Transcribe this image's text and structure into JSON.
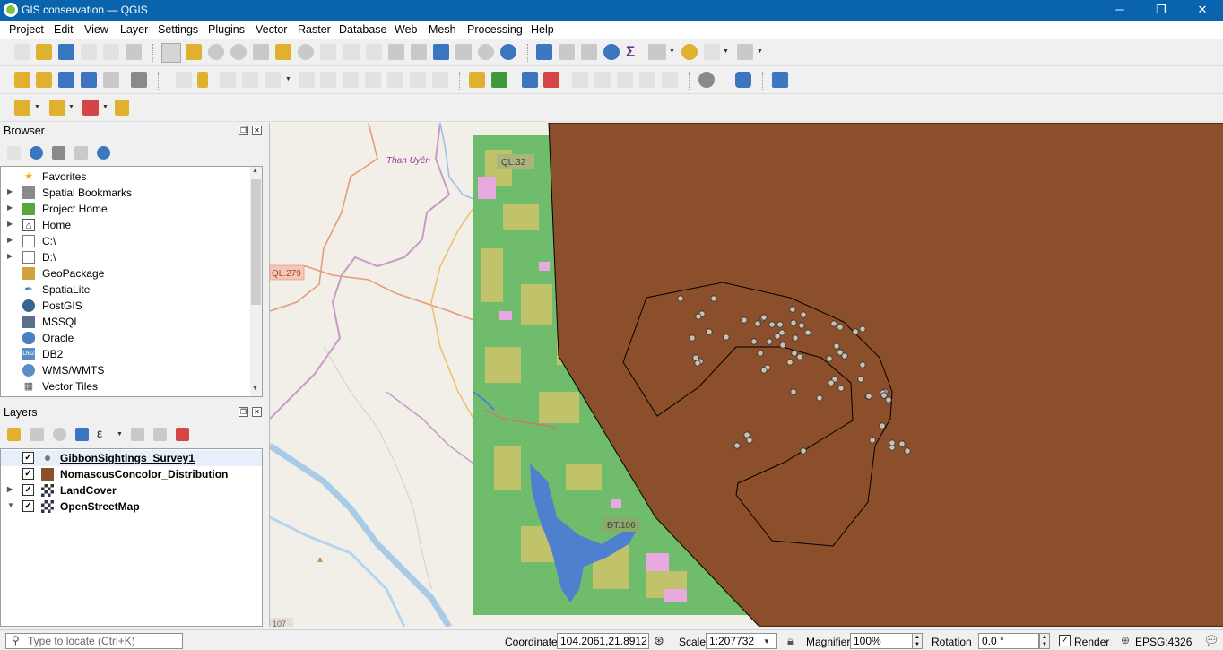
{
  "window": {
    "title": "GIS conservation — QGIS",
    "controls": [
      "─",
      "❐",
      "✕"
    ]
  },
  "menu": [
    "Project",
    "Edit",
    "View",
    "Layer",
    "Settings",
    "Plugins",
    "Vector",
    "Raster",
    "Database",
    "Web",
    "Mesh",
    "Processing",
    "Help"
  ],
  "browser": {
    "title": "Browser",
    "items": [
      {
        "label": "Favorites",
        "icon": "star-icon",
        "arrow": ""
      },
      {
        "label": "Spatial Bookmarks",
        "icon": "bookmark-icon",
        "arrow": "▶"
      },
      {
        "label": "Project Home",
        "icon": "project-home-icon",
        "arrow": "▶"
      },
      {
        "label": "Home",
        "icon": "home-icon",
        "arrow": "▶"
      },
      {
        "label": "C:\\",
        "icon": "folder-icon",
        "arrow": "▶"
      },
      {
        "label": "D:\\",
        "icon": "folder-icon",
        "arrow": "▶"
      },
      {
        "label": "GeoPackage",
        "icon": "geopackage-icon",
        "arrow": ""
      },
      {
        "label": "SpatiaLite",
        "icon": "spatialite-icon",
        "arrow": ""
      },
      {
        "label": "PostGIS",
        "icon": "postgis-icon",
        "arrow": ""
      },
      {
        "label": "MSSQL",
        "icon": "mssql-icon",
        "arrow": ""
      },
      {
        "label": "Oracle",
        "icon": "oracle-icon",
        "arrow": ""
      },
      {
        "label": "DB2",
        "icon": "db2-icon",
        "arrow": ""
      },
      {
        "label": "WMS/WMTS",
        "icon": "globe-icon",
        "arrow": ""
      },
      {
        "label": "Vector Tiles",
        "icon": "grid-icon",
        "arrow": ""
      }
    ]
  },
  "layers": {
    "title": "Layers",
    "items": [
      {
        "label": "GibbonSightings_Survey1",
        "checked": true,
        "symbol": "point",
        "arrow": ""
      },
      {
        "label": "NomascusConcolor_Distribution",
        "checked": true,
        "symbol": "fill",
        "arrow": ""
      },
      {
        "label": "LandCover",
        "checked": true,
        "symbol": "raster",
        "arrow": "▶"
      },
      {
        "label": "OpenStreetMap",
        "checked": true,
        "symbol": "raster",
        "arrow": "▼"
      }
    ]
  },
  "map": {
    "labels": {
      "town": "Than Uyên",
      "road1": "QL.32",
      "road2": "QL.279",
      "road3": "ĐT.106",
      "road4": "107"
    },
    "colors": {
      "distribution": "#8b4f2b",
      "landcover": "#6fbd6c",
      "water": "#4f7fcf",
      "sightings": "#c8c0b0"
    },
    "sightings_count": 64
  },
  "status": {
    "locate_placeholder": "Type to locate (Ctrl+K)",
    "coordinate_label": "Coordinate",
    "coordinate": "104.2061,21.8912",
    "scale_label": "Scale",
    "scale": "1:207732",
    "magnifier_label": "Magnifier",
    "magnifier": "100%",
    "rotation_label": "Rotation",
    "rotation": "0.0 °",
    "render_label": "Render",
    "crs": "EPSG:4326"
  }
}
